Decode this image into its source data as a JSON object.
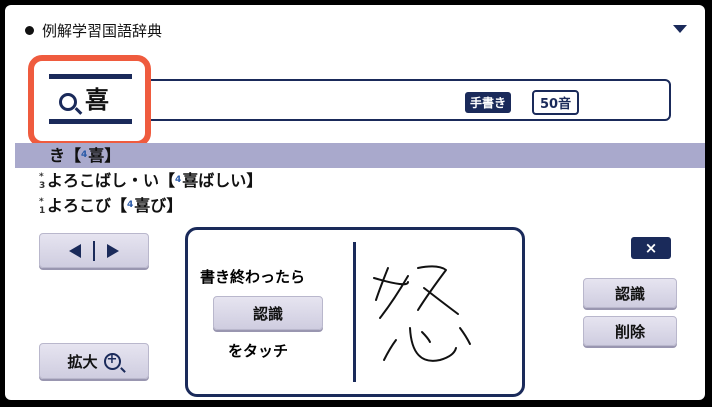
{
  "header": {
    "dictionary_title": "例解学習国語辞典"
  },
  "search": {
    "query": "喜",
    "handwriting_label": "手書き",
    "kana_label": "50音"
  },
  "results": [
    {
      "reading": "き",
      "open": "【",
      "grade": "4",
      "kanji": "喜",
      "close": "】",
      "selected": true
    },
    {
      "mark_top": "*",
      "mark_num": "3",
      "reading": "よろこばし・い",
      "open": "【",
      "grade": "4",
      "kanji": "喜ばしい",
      "close": "】",
      "selected": false
    },
    {
      "mark_top": "*",
      "mark_num": "1",
      "reading": "よろこび",
      "open": "【",
      "grade": "4",
      "kanji": "喜び",
      "close": "】",
      "selected": false
    }
  ],
  "handwriting": {
    "line1": "書き終わったら",
    "recognize_label": "認識",
    "line2": "をタッチ"
  },
  "sidebar": {
    "close_label": "×",
    "recognize_label": "認識",
    "delete_label": "削除"
  },
  "zoom": {
    "label": "拡大"
  },
  "colors": {
    "navy": "#1a2a5a",
    "highlight": "#ef5b3e",
    "selected_row": "#a9a9cc"
  }
}
